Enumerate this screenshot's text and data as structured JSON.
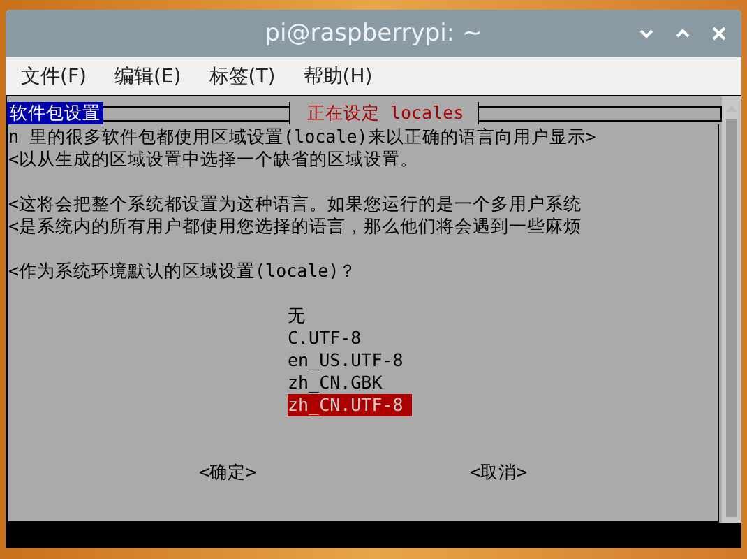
{
  "window": {
    "title": "pi@raspberrypi: ~"
  },
  "menu": [
    {
      "label": "文件(F)"
    },
    {
      "label": "编辑(E)"
    },
    {
      "label": "标签(T)"
    },
    {
      "label": "帮助(H)"
    }
  ],
  "terminal": {
    "backtitle": "软件包设置",
    "dialog_title": "正在设定 locales",
    "paragraphs": [
      [
        "n 里的很多软件包都使用区域设置(locale)来以正确的语言向用户显示>",
        "<以从生成的区域设置中选择一个缺省的区域设置。"
      ],
      [
        "<这将会把整个系统都设置为这种语言。如果您运行的是一个多用户系统",
        "<是系统内的所有用户都使用您选择的语言，那么他们将会遇到一些麻烦"
      ],
      [
        "<作为系统环境默认的区域设置(locale)？"
      ]
    ],
    "options": [
      {
        "label": "无",
        "selected": false
      },
      {
        "label": "C.UTF-8",
        "selected": false
      },
      {
        "label": "en_US.UTF-8",
        "selected": false
      },
      {
        "label": "zh_CN.GBK",
        "selected": false
      },
      {
        "label": "zh_CN.UTF-8",
        "selected": true
      }
    ],
    "buttons": [
      "<确定>",
      "<取消>"
    ]
  }
}
